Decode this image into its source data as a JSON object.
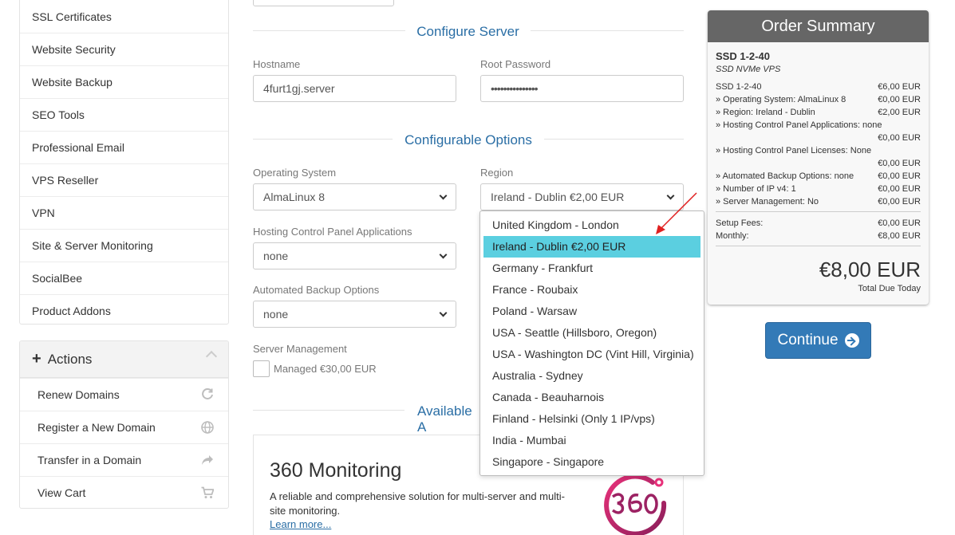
{
  "sidebar": {
    "items": [
      {
        "label": "SSL Certificates"
      },
      {
        "label": "Website Security"
      },
      {
        "label": "Website Backup"
      },
      {
        "label": "SEO Tools"
      },
      {
        "label": "Professional Email"
      },
      {
        "label": "VPS Reseller"
      },
      {
        "label": "VPN"
      },
      {
        "label": "Site & Server Monitoring"
      },
      {
        "label": "SocialBee"
      },
      {
        "label": "Product Addons"
      }
    ]
  },
  "actions": {
    "title": "Actions",
    "items": [
      {
        "label": "Renew Domains",
        "icon": "refresh-icon"
      },
      {
        "label": "Register a New Domain",
        "icon": "globe-icon"
      },
      {
        "label": "Transfer in a Domain",
        "icon": "share-arrow-icon"
      },
      {
        "label": "View Cart",
        "icon": "cart-icon"
      }
    ]
  },
  "configure_server": {
    "title": "Configure Server",
    "hostname_label": "Hostname",
    "hostname_value": "4furt1gj.server",
    "root_password_label": "Root Password",
    "root_password_value": "•••••••••••••••"
  },
  "configurable_options": {
    "title": "Configurable Options",
    "os_label": "Operating System",
    "os_value": "AlmaLinux 8",
    "region_label": "Region",
    "region_value": "Ireland - Dublin €2,00 EUR",
    "cpanel_apps_label": "Hosting Control Panel Applications",
    "cpanel_apps_value": "none",
    "backup_label": "Automated Backup Options",
    "backup_value": "none",
    "server_mgmt_label": "Server Management",
    "server_mgmt_option": "Managed €30,00 EUR"
  },
  "region_dropdown": {
    "options": [
      "United Kingdom - London",
      "Ireland - Dublin €2,00 EUR",
      "Germany - Frankfurt",
      "France - Roubaix",
      "Poland - Warsaw",
      "USA - Seattle (Hillsboro, Oregon)",
      "USA - Washington DC (Vint Hill, Virginia)",
      "Australia - Sydney",
      "Canada - Beauharnois",
      "Finland - Helsinki (Only 1 IP/vps)",
      "India - Mumbai",
      "Singapore - Singapore"
    ],
    "selected_index": 1,
    "highlight_color": "#5bcfe0"
  },
  "available_addons": {
    "title_visible": "Available A",
    "product_title": "360 Monitoring",
    "product_desc": "A reliable and comprehensive solution for multi-server and multi-site monitoring.",
    "learn_more": "Learn more..."
  },
  "order_summary": {
    "title": "Order Summary",
    "product_name": "SSD 1-2-40",
    "product_group": "SSD NVMe VPS",
    "lines": [
      {
        "label": "SSD 1-2-40",
        "value": "€6,00 EUR"
      },
      {
        "label": "» Operating System: AlmaLinux 8",
        "value": "€0,00 EUR"
      },
      {
        "label": "» Region: Ireland - Dublin",
        "value": "€2,00 EUR"
      },
      {
        "label": "» Hosting Control Panel Applications: none",
        "value": "€0,00 EUR"
      },
      {
        "label": "» Hosting Control Panel Licenses: None",
        "value": "€0,00 EUR"
      },
      {
        "label": "» Automated Backup Options: none",
        "value": "€0,00 EUR"
      },
      {
        "label": "» Number of IP v4: 1",
        "value": "€0,00 EUR"
      },
      {
        "label": "» Server Management: No",
        "value": "€0,00 EUR"
      }
    ],
    "setup_fees_label": "Setup Fees:",
    "setup_fees_value": "€0,00 EUR",
    "monthly_label": "Monthly:",
    "monthly_value": "€8,00 EUR",
    "total": "€8,00 EUR",
    "total_label": "Total Due Today"
  },
  "continue_label": "Continue",
  "colors": {
    "accent": "#337ab7",
    "section_title": "#2a6ea5",
    "summary_header": "#666666",
    "annotation_arrow": "#e02020"
  }
}
